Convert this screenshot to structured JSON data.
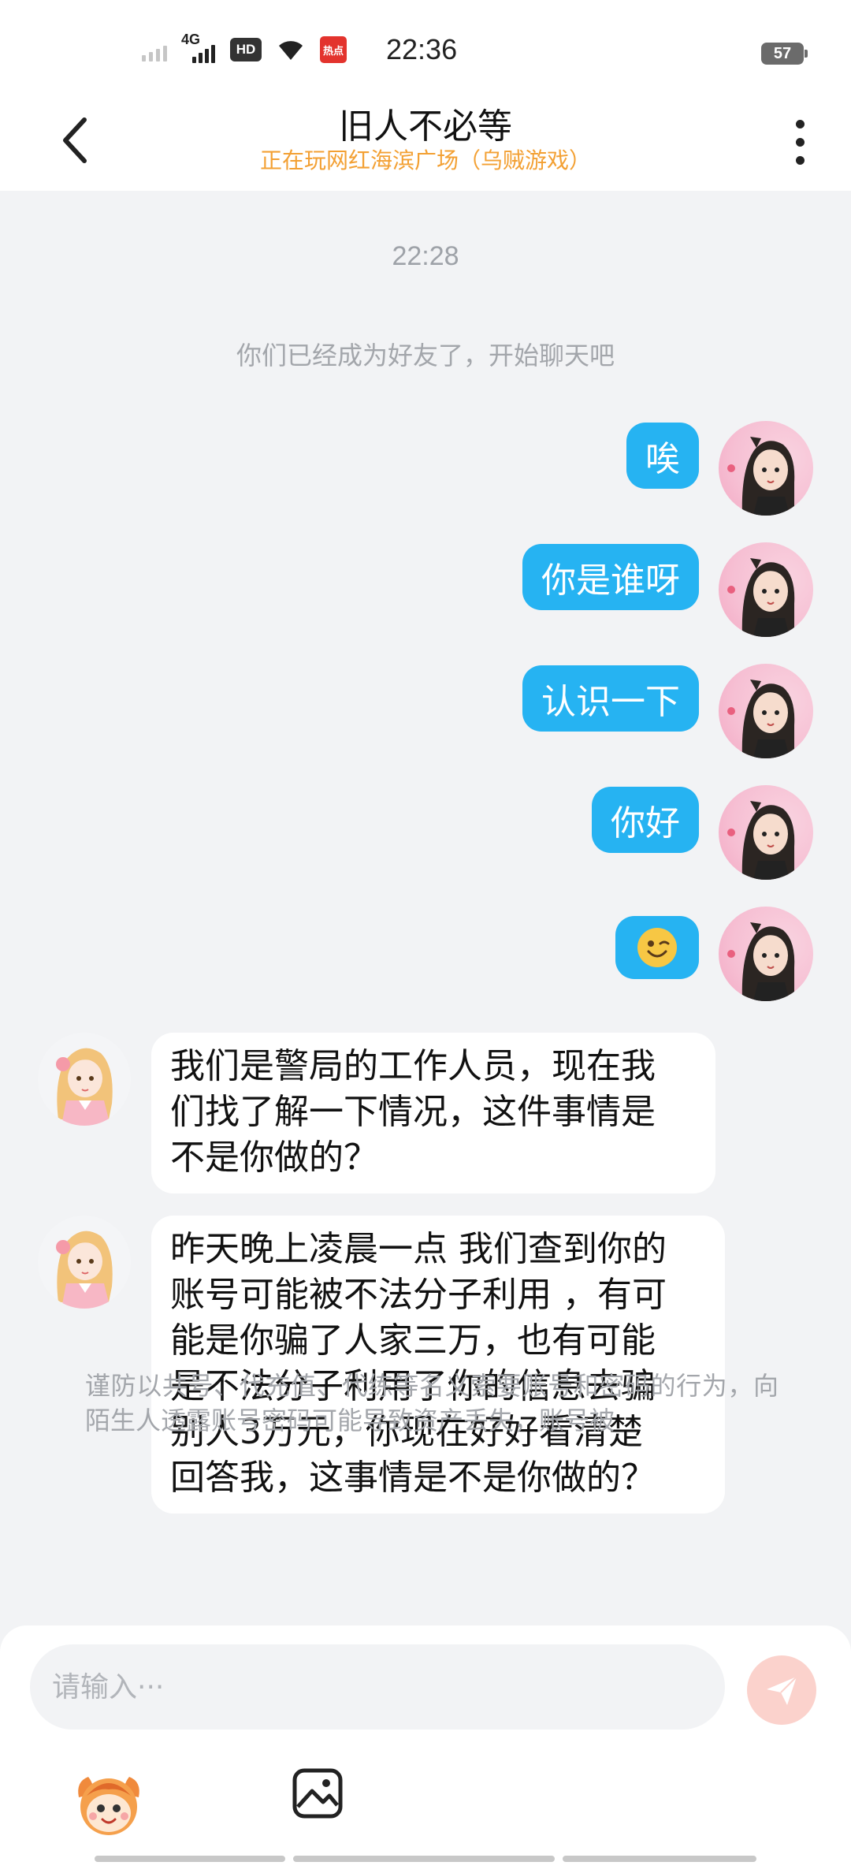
{
  "status_bar": {
    "time": "22:36",
    "battery": "57",
    "network": "4G",
    "hd": "HD",
    "app_badge": "热点"
  },
  "header": {
    "title": "旧人不必等",
    "subtitle": "正在玩网红海滨广场（乌贼游戏）",
    "subtitle_color": "#f3a033"
  },
  "chat": {
    "timestamp": "22:28",
    "system_notice": "你们已经成为好友了，开始聊天吧",
    "outgoing": [
      {
        "text": "唉"
      },
      {
        "text": "你是谁呀"
      },
      {
        "text": "认识一下"
      },
      {
        "text": "你好"
      },
      {
        "text": "😉"
      }
    ],
    "incoming": [
      {
        "lines": [
          "我们是警局的工作人员，现在我",
          "们找了解一下情况，这件事情是",
          "不是你做的？"
        ]
      },
      {
        "lines": [
          "昨天晚上凌晨一点 我们查到你的",
          "账号可能被不法分子利用 ，有可",
          "能是你骗了人家三万，也有可能",
          "是不法分子利用了你的信息去骗",
          "别人3万元，你现在好好看清楚",
          "回答我，这事情是不是你做的？"
        ]
      }
    ],
    "warning": "谨防以共号、代充值、代练等名义索要账号和密码的行为，向陌生人透露账号密码可能导致资产丢失，账号被"
  },
  "input": {
    "placeholder": "请输入···"
  },
  "colors": {
    "outgoing_bubble": "#26b3f2",
    "send_button": "#fbd2cc"
  }
}
